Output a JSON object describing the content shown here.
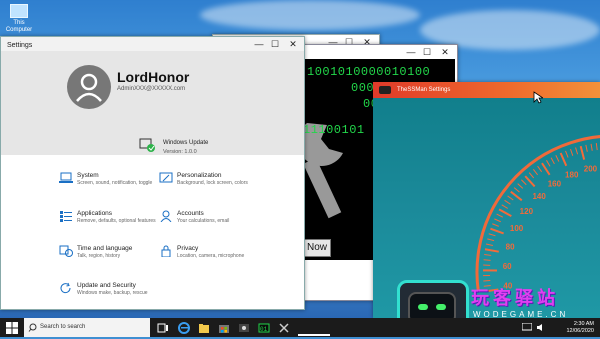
{
  "desktop": {
    "icons": [
      {
        "label": "This Computer"
      }
    ]
  },
  "windows": {
    "back": {
      "controls": [
        "—",
        "☐",
        "✕"
      ]
    },
    "matrix": {
      "lines": [
        "1001010000010100",
        "0000111001",
        "0001011",
        "11100101"
      ],
      "now_button": "Now",
      "controls": [
        "—",
        "☐",
        "✕"
      ]
    },
    "settings": {
      "title": "Settings",
      "controls": [
        "—",
        "☐",
        "✕"
      ],
      "user": {
        "name": "LordHonor",
        "email": "AdminXXX@XXXXX.com"
      },
      "update": {
        "title": "Windows Update",
        "version": "Version: 1.0.0"
      },
      "categories": [
        {
          "title": "System",
          "desc": "Screen, sound, notification, toggle",
          "icon": "laptop-icon"
        },
        {
          "title": "Personalization",
          "desc": "Background, lock screen, colors",
          "icon": "paint-icon"
        },
        {
          "title": "Applications",
          "desc": "Remove, defaults, optional features",
          "icon": "apps-icon"
        },
        {
          "title": "Accounts",
          "desc": "Your calculations, email",
          "icon": "person-icon"
        },
        {
          "title": "Time and language",
          "desc": "Talk, region, history",
          "icon": "clock-language-icon"
        },
        {
          "title": "Privacy",
          "desc": "Location, camera, microphone",
          "icon": "lock-icon"
        },
        {
          "title": "Update and Security",
          "desc": "Windows make, backup, rescue",
          "icon": "refresh-icon"
        }
      ]
    },
    "ssman": {
      "title": "TheSSMan Settings",
      "gauge_labels": [
        "20",
        "40",
        "60",
        "80",
        "100",
        "120",
        "140",
        "160",
        "180",
        "200",
        "220",
        "240"
      ],
      "watermark": {
        "text": "玩客驿站",
        "url": "WODEGAME.CN"
      }
    }
  },
  "taskbar": {
    "search_placeholder": "Search to search",
    "time": "2:30 AM",
    "date": "12/06/2020",
    "icons": [
      "task-view-icon",
      "edge-icon",
      "explorer-icon",
      "store-icon",
      "app-icon",
      "app2-icon",
      "app3-icon",
      "app4-icon",
      "settings-gear-icon"
    ]
  },
  "colors": {
    "accent": "#0078d7",
    "matrix_green": "#22d64a",
    "ss_title": "#e03a2a",
    "watermark": "#e03ff0"
  }
}
